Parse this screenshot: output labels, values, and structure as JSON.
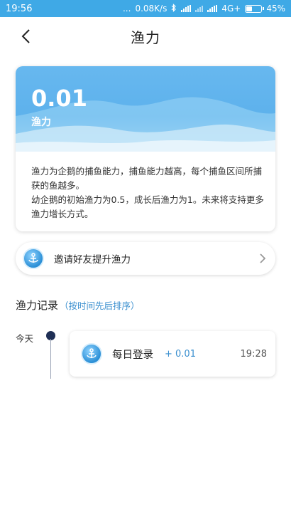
{
  "status_bar": {
    "time": "19:56",
    "dots": "...",
    "net_speed": "0.08K/s",
    "network": "4G+",
    "battery": "45%",
    "battery_level": 0.45
  },
  "nav": {
    "title": "渔力",
    "back_icon": "chevron-left-icon"
  },
  "summary_card": {
    "value": "0.01",
    "value_label": "渔力",
    "description_lines": [
      "渔力为企鹅的捕鱼能力，捕鱼能力越高，每个捕鱼区间所捕获的鱼越多。",
      "幼企鹅的初始渔力为0.5，成长后渔力为1。未来将支持更多渔力增长方式。"
    ]
  },
  "invite": {
    "label": "邀请好友提升渔力",
    "icon": "anchor-icon",
    "chevron_icon": "chevron-right-icon"
  },
  "records": {
    "title": "渔力记录",
    "subtitle": "（按时间先后排序）",
    "groups": [
      {
        "date": "今天",
        "items": [
          {
            "name": "每日登录",
            "delta": "+ 0.01",
            "time": "19:28",
            "icon": "anchor-icon"
          }
        ]
      }
    ]
  },
  "colors": {
    "status_bar": "#3fa9e6",
    "accent": "#3a8fcf",
    "timeline_dot": "#1f2f55"
  }
}
